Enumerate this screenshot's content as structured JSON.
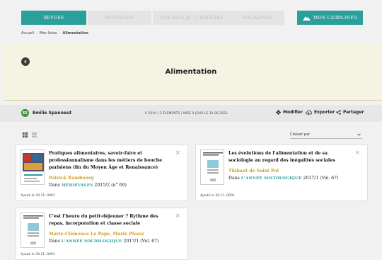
{
  "nav": {
    "tabs": [
      {
        "label": "Revues",
        "active": true
      },
      {
        "label": "Ouvrages",
        "active": false
      },
      {
        "label": "Que sais-je ? / Repères",
        "active": false
      },
      {
        "label": "Magazines",
        "active": false
      }
    ],
    "mycairn_label": "Mon cairn.info"
  },
  "breadcrumb": [
    "Accueil",
    "Mes listes",
    "Alimentation"
  ],
  "list": {
    "title": "Alimentation",
    "owner_initials": "ES",
    "owner": "Emilie Spanneut",
    "meta": "0 suivi | 3 éléments | Mise à jour le 20.06.2022",
    "actions": {
      "modify": "Modifier",
      "export": "Exporter",
      "share": "Partager"
    }
  },
  "sort": {
    "label": "Classer par"
  },
  "items": [
    {
      "title": "Pratiques alimentaires, savoir-faire et professionnalisme dans les métiers de bouche parisiens (fin du Moyen Âge et Renaissance)",
      "author": "Patrick Rambourg",
      "in_prefix": "Dans",
      "revue": "Médiévales",
      "issue": "2015/2 (n° 69)",
      "added": "Ajouté le 30.11.-0001",
      "thumb_label": "Médiévales"
    },
    {
      "title": "Les évolutions de l'alimentation et de sa sociologie au regard des inégalités sociales",
      "author": "Thibaut de Saint Pol",
      "in_prefix": "Dans",
      "revue": "L'Année sociologique",
      "issue": "2017/1 (Vol. 67)",
      "added": "Ajouté le 30.11.-0001",
      "thumb_label": "L'Année sociologique"
    },
    {
      "title": "C'est l'heure du petit-déjeuner ? Rythme des repas, incorporation et classe sociale",
      "author": "Marie-Clémence Le Pape, Marie Plessz",
      "in_prefix": "Dans",
      "revue": "L'Année sociologique",
      "issue": "2017/1 (Vol. 67)",
      "added": "Ajouté le 30.11.-0001",
      "thumb_label": "L'Année sociologique"
    }
  ],
  "colors": {
    "accent": "#2a9f9b",
    "author": "#c9a227",
    "band": "#f5f3e2"
  }
}
